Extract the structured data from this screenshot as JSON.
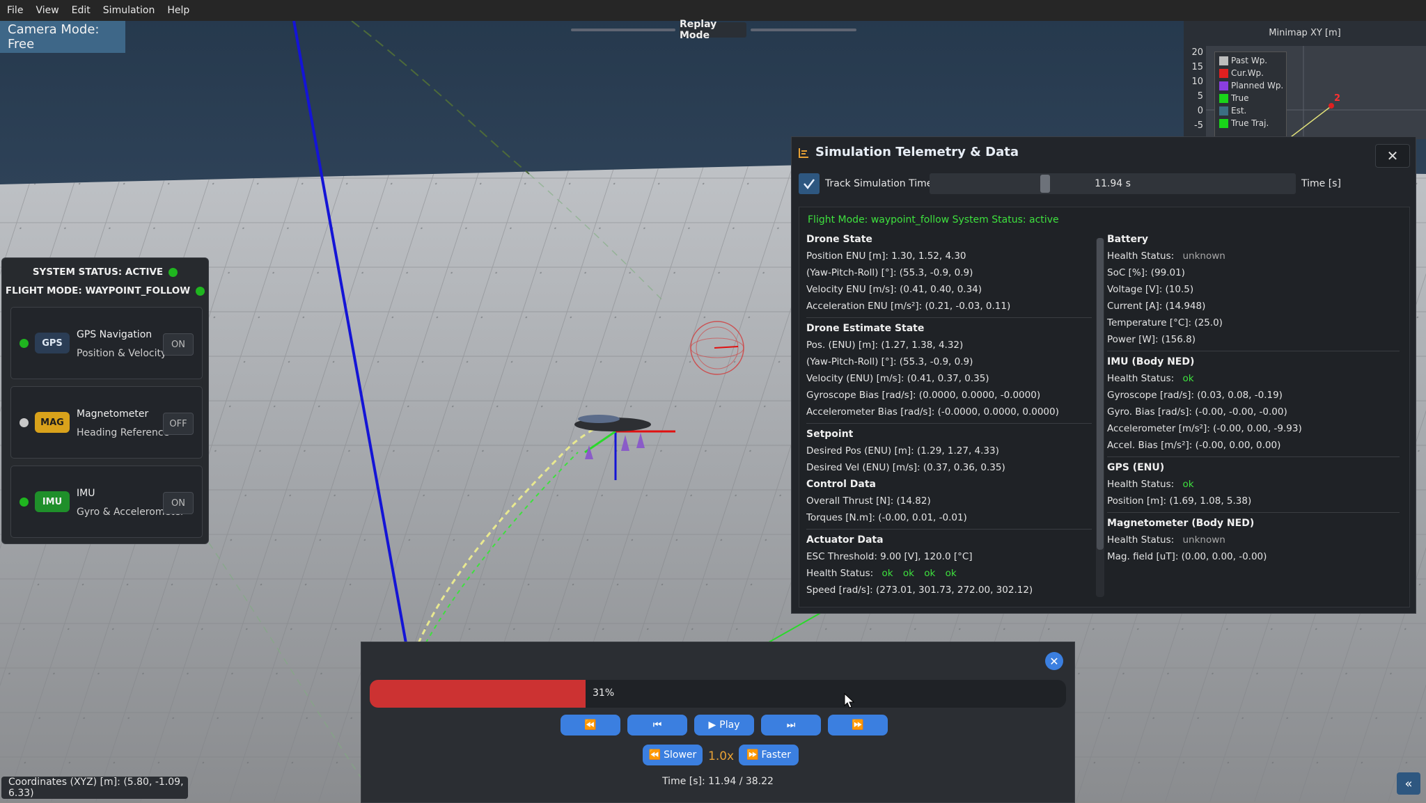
{
  "menu": [
    "File",
    "View",
    "Edit",
    "Simulation",
    "Help"
  ],
  "camera_mode": "Camera Mode: Free",
  "replay_mode_label": "Replay Mode",
  "minimap": {
    "title": "Minimap XY [m]",
    "y_ticks": [
      "20",
      "15",
      "10",
      "5",
      "0",
      "-5"
    ],
    "legend": [
      {
        "label": "Past Wp.",
        "color": "#bdbdbd"
      },
      {
        "label": "Cur.Wp.",
        "color": "#e02020"
      },
      {
        "label": "Planned Wp.",
        "color": "#8a3ee0"
      },
      {
        "label": "True",
        "color": "#19d419"
      },
      {
        "label": "Est.",
        "color": "#3c6e82"
      },
      {
        "label": "True Traj.",
        "color": "#19d419"
      }
    ],
    "waypoint_label": "2"
  },
  "status_panel": {
    "system_status": "SYSTEM STATUS: ACTIVE",
    "flight_mode": "FLIGHT MODE: WAYPOINT_FOLLOW",
    "sensors": [
      {
        "badge": "GPS",
        "name": "GPS Navigation",
        "desc": "Position & Velocity",
        "state": "ON",
        "active": true,
        "badge_color": "#2b3d55",
        "badge_text": "#dfe8f3"
      },
      {
        "badge": "MAG",
        "name": "Magnetometer",
        "desc": "Heading Reference",
        "state": "OFF",
        "active": false,
        "badge_color": "#d9a21b",
        "badge_text": "#1d1d1d"
      },
      {
        "badge": "IMU",
        "name": "IMU",
        "desc": "Gyro & Accelerometer",
        "state": "ON",
        "active": true,
        "badge_color": "#1f8f2a",
        "badge_text": "#f0f0f0"
      }
    ]
  },
  "telemetry": {
    "title": "Simulation Telemetry & Data",
    "close": "✕",
    "track_label": "Track Simulation Time",
    "time_value": "11.94 s",
    "time_progress": 0.31,
    "time_unit": "Time [s]",
    "flight_line": "Flight Mode: waypoint_follow  System Status: active",
    "drone_state": {
      "title": "Drone State",
      "rows": [
        "Position ENU [m]: 1.30, 1.52, 4.30",
        "(Yaw-Pitch-Roll) [°]: (55.3, -0.9, 0.9)",
        "Velocity ENU [m/s]: (0.41, 0.40, 0.34)",
        "Acceleration ENU [m/s²]: (0.21, -0.03, 0.11)"
      ]
    },
    "drone_estimate": {
      "title": "Drone Estimate State",
      "rows": [
        "Pos. (ENU) [m]: (1.27, 1.38, 4.32)",
        "(Yaw-Pitch-Roll) [°]: (55.3, -0.9, 0.9)",
        "Velocity (ENU) [m/s]: (0.41, 0.37, 0.35)",
        "Gyroscope Bias [rad/s]: (0.0000, 0.0000, -0.0000)",
        "Accelerometer Bias [rad/s]: (-0.0000, 0.0000, 0.0000)"
      ]
    },
    "setpoint": {
      "title": "Setpoint",
      "rows": [
        "Desired Pos (ENU) [m]: (1.29, 1.27, 4.33)",
        "Desired Vel (ENU) [m/s]: (0.37, 0.36, 0.35)"
      ]
    },
    "control": {
      "title": "Control Data",
      "rows": [
        "Overall Thrust [N]: (14.82)",
        "Torques [N.m]: (-0.00, 0.01, -0.01)"
      ]
    },
    "actuator": {
      "title": "Actuator Data",
      "esc": "ESC Threshold: 9.00 [V], 120.0 [°C]",
      "health_label": "Health Status:",
      "health": [
        "ok",
        "ok",
        "ok",
        "ok"
      ],
      "speed": "Speed [rad/s]: (273.01, 301.73, 272.00, 302.12)"
    },
    "battery": {
      "title": "Battery",
      "health_label": "Health Status:",
      "health": "unknown",
      "rows": [
        "SoC [%]: (99.01)",
        "Voltage [V]: (10.5)",
        "Current [A]: (14.948)",
        "Temperature [°C]: (25.0)",
        "Power [W]: (156.8)"
      ]
    },
    "imu": {
      "title": "IMU (Body NED)",
      "health_label": "Health Status:",
      "health": "ok",
      "rows": [
        "Gyroscope [rad/s]: (0.03, 0.08, -0.19)",
        "Gyro. Bias [rad/s]: (-0.00, -0.00, -0.00)",
        "Accelerometer [m/s²]: (-0.00, 0.00, -9.93)",
        "Accel. Bias [m/s²]: (-0.00, 0.00, 0.00)"
      ]
    },
    "gps": {
      "title": "GPS (ENU)",
      "health_label": "Health Status:",
      "health": "ok",
      "rows": [
        "Position [m]: (1.69, 1.08, 5.38)"
      ]
    },
    "mag": {
      "title": "Magnetometer (Body NED)",
      "health_label": "Health Status:",
      "health": "unknown",
      "rows": [
        "Mag. field [uT]: (0.00, 0.00, -0.00)"
      ]
    }
  },
  "replay": {
    "progress": 0.31,
    "progress_label": "31%",
    "play_label": "Play",
    "slower_label": "Slower",
    "faster_label": "Faster",
    "speed": "1.0x",
    "time_label": "Time [s]: 11.94 / 38.22"
  },
  "coordinates": "Coordinates (XYZ) [m]: (5.80, -1.09, 6.33)"
}
